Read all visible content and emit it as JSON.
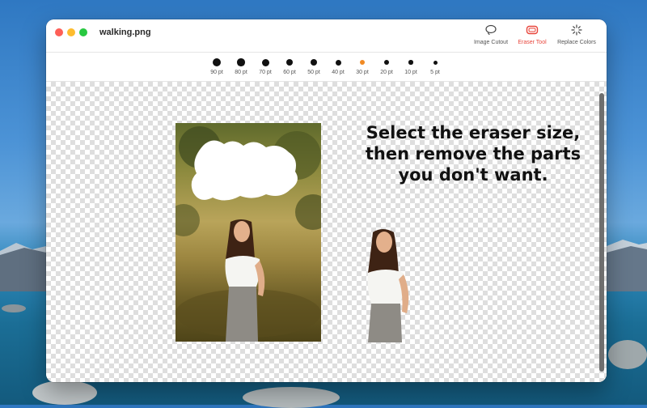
{
  "window": {
    "title": "walking.png"
  },
  "toolbar": {
    "tools": [
      {
        "label": "Image Cutout",
        "icon": "lasso-icon"
      },
      {
        "label": "Eraser Tool",
        "icon": "eraser-icon",
        "active": true
      },
      {
        "label": "Replace Colors",
        "icon": "sparkle-icon"
      }
    ]
  },
  "eraser_sizes": {
    "options": [
      "90 pt",
      "80 pt",
      "70 pt",
      "60 pt",
      "50 pt",
      "40 pt",
      "30 pt",
      "20 pt",
      "10 pt",
      "5 pt"
    ],
    "selected": "30 pt"
  },
  "canvas": {
    "headline_lines": [
      "Select the eraser size,",
      "then remove the parts",
      "you don't want."
    ]
  },
  "colors": {
    "accent": "#e8463c",
    "selected_size": "#f08a24"
  }
}
